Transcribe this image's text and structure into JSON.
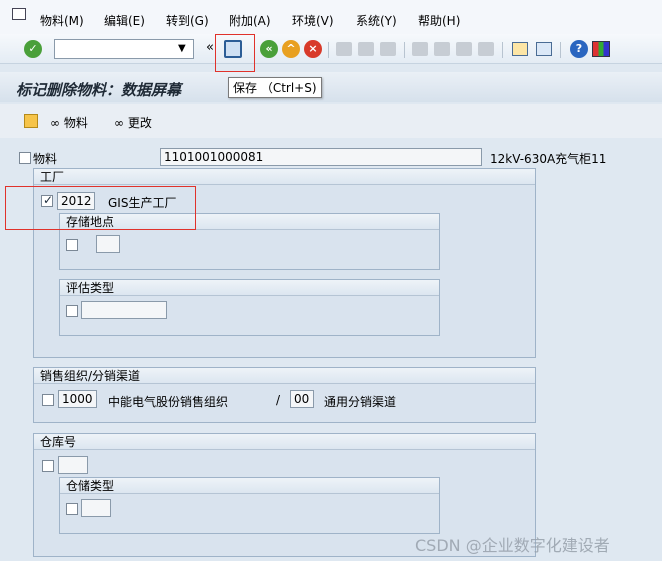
{
  "menu": [
    "物料(M)",
    "编辑(E)",
    "转到(G)",
    "附加(A)",
    "环境(V)",
    "系统(Y)",
    "帮助(H)"
  ],
  "toolbar": {
    "command_value": "",
    "tooltip": "保存 （Ctrl+S)"
  },
  "title": "标记删除物料：数据屏幕",
  "app_toolbar": {
    "material_label": "物料",
    "change_label": "更改"
  },
  "material": {
    "label": "物料",
    "number": "1101001000081",
    "description": "12kV-630A充气柜11"
  },
  "plant_group": {
    "title": "工厂",
    "code": "2012",
    "name": "GIS生产工厂",
    "storage_title": "存储地点",
    "valuation_title": "评估类型"
  },
  "sales_group": {
    "title": "销售组织/分销渠道",
    "org_code": "1000",
    "org_name": "中能电气股份销售组织",
    "separator": "/",
    "channel_code": "00",
    "channel_name": "通用分销渠道"
  },
  "warehouse_group": {
    "title": "仓库号",
    "storage_type_title": "仓储类型"
  },
  "watermark": "CSDN @企业数字化建设者"
}
